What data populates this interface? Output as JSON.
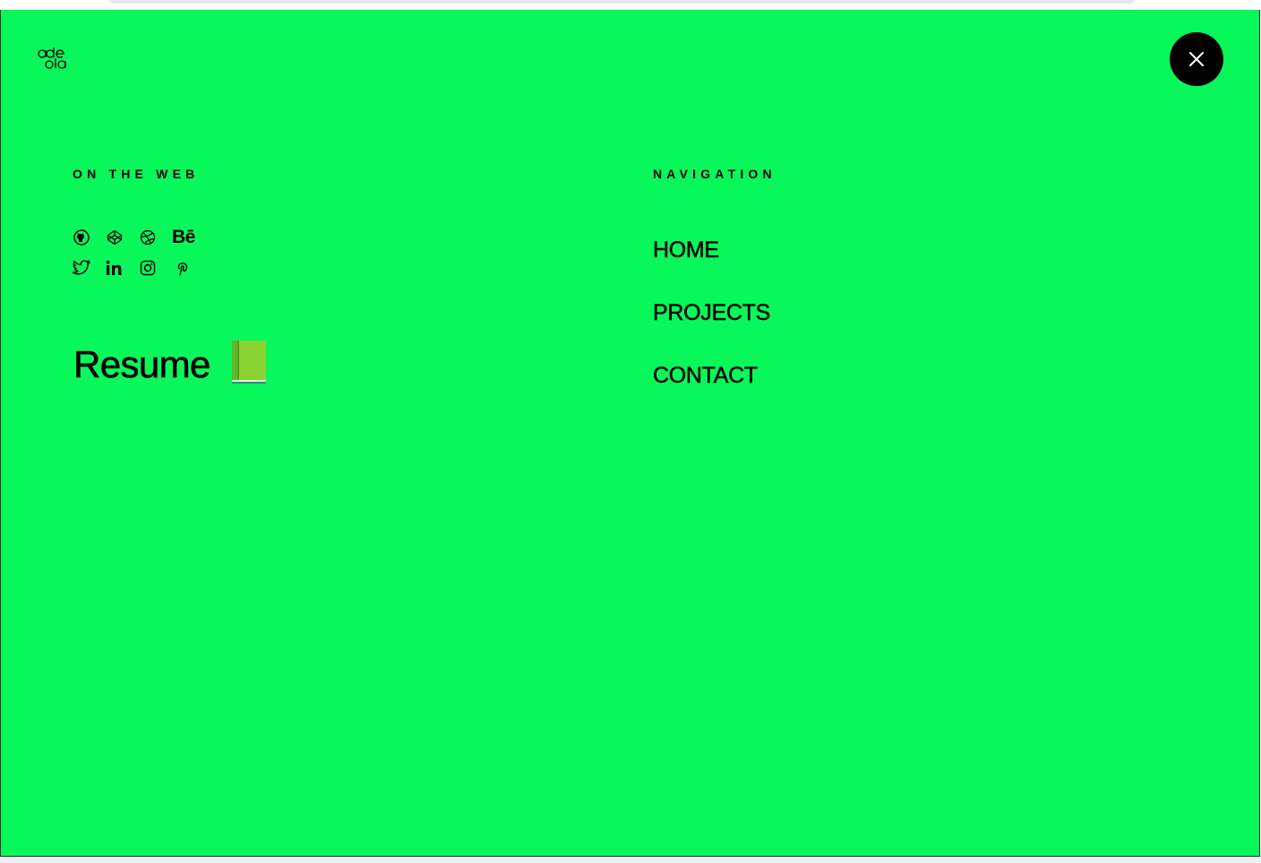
{
  "colors": {
    "overlay_bg": "#08f75a",
    "text": "#000000",
    "close_bg": "#000000"
  },
  "logo": {
    "text_top": "ade",
    "text_bottom": "ola"
  },
  "close": {
    "icon": "close-icon"
  },
  "web": {
    "heading": "ON THE WEB",
    "links_row1": [
      "github-icon",
      "codepen-icon",
      "dribbble-icon",
      "behance-icon"
    ],
    "links_row2": [
      "twitter-icon",
      "linkedin-icon",
      "instagram-icon",
      "pinterest-icon"
    ],
    "behance_text": "Bē"
  },
  "resume": {
    "label": "Resume",
    "icon": "green-book-icon"
  },
  "navigation": {
    "heading": "NAVIGATION",
    "items": [
      {
        "label": "HOME"
      },
      {
        "label": "PROJECTS"
      },
      {
        "label": "CONTACT"
      }
    ]
  }
}
